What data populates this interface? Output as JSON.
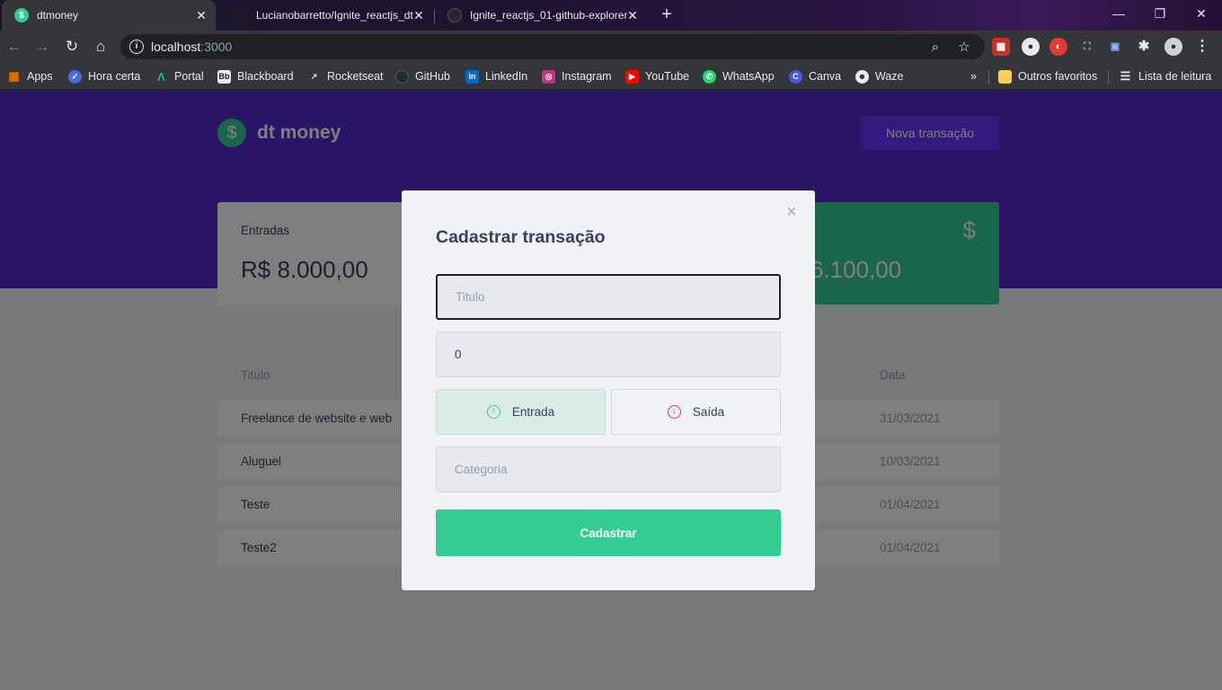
{
  "browser": {
    "tabs": [
      {
        "title": "dtmoney"
      },
      {
        "title": "Lucianobarretto/Ignite_reactjs_dt"
      },
      {
        "title": "Ignite_reactjs_01-github-explorer"
      }
    ],
    "url_host": "localhost",
    "url_port": ":3000",
    "bookmarks": [
      "Apps",
      "Hora certa",
      "Portal",
      "Blackboard",
      "Rocketseat",
      "GitHub",
      "LinkedIn",
      "Instagram",
      "YouTube",
      "WhatsApp",
      "Canva",
      "Waze"
    ],
    "bookmark_overflow": "»",
    "other_bookmarks": "Outros favoritos",
    "reading_list": "Lista de leitura"
  },
  "app": {
    "brand": "dt money",
    "new_transaction_label": "Nova transação",
    "summary": {
      "income_label": "Entradas",
      "income_value": "R$ 8.000,00",
      "total_value_visible": "6.100,00",
      "total_icon": "$"
    },
    "table": {
      "headers": {
        "title": "Titulo",
        "date": "Data"
      },
      "rows": [
        {
          "title": "Freelance de website e web",
          "date": "31/03/2021"
        },
        {
          "title": "Aluguel",
          "date": "10/03/2021"
        },
        {
          "title": "Teste",
          "date": "01/04/2021"
        },
        {
          "title": "Teste2",
          "date": "01/04/2021"
        }
      ]
    }
  },
  "modal": {
    "title": "Cadastrar transação",
    "close_icon": "×",
    "title_placeholder": "Titulo",
    "amount_value": "0",
    "income_label": "Entrada",
    "outcome_label": "Saída",
    "category_placeholder": "Categoria",
    "submit_label": "Cadastrar"
  },
  "colors": {
    "brand_purple": "#5429cc",
    "button_purple": "#6933ff",
    "green": "#33cc95",
    "red": "#e52e4d",
    "title_text": "#363f5f"
  }
}
